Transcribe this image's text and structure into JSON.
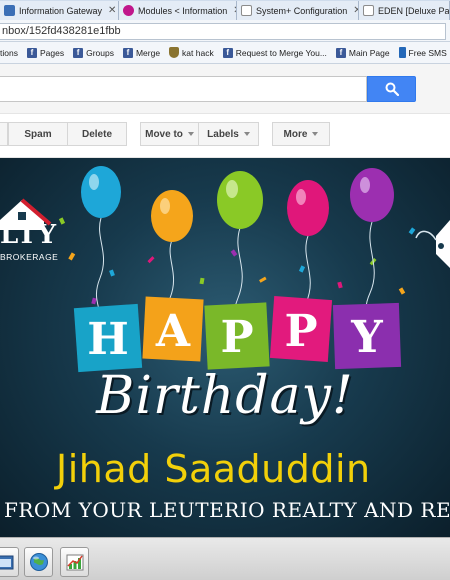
{
  "browser": {
    "tabs": [
      {
        "label": "Information Gateway",
        "icon": "fav-blue"
      },
      {
        "label": "Modules < Information",
        "icon": "fav-pink"
      },
      {
        "label": "System+ Configuration",
        "icon": "fav-doc"
      },
      {
        "label": "EDEN [Deluxe Packa",
        "icon": "fav-doc"
      }
    ],
    "address": "nbox/152fd438281e1fbb",
    "bookmarks": [
      {
        "label": "tions",
        "icon": "none"
      },
      {
        "label": "Pages",
        "icon": "facebook-icon"
      },
      {
        "label": "Groups",
        "icon": "facebook-icon"
      },
      {
        "label": "Merge",
        "icon": "facebook-icon"
      },
      {
        "label": "kat hack",
        "icon": "shield-icon"
      },
      {
        "label": "Request to Merge You...",
        "icon": "facebook-icon"
      },
      {
        "label": "Main Page",
        "icon": "facebook-icon"
      },
      {
        "label": "Free SMS",
        "icon": "mobile-icon"
      }
    ]
  },
  "gmail": {
    "search_value": "",
    "toolbar": {
      "spam": "Spam",
      "delete": "Delete",
      "move_to": "Move to",
      "labels": "Labels",
      "more": "More"
    }
  },
  "card": {
    "logo_main": "LTY",
    "logo_sub": "BROKERAGE",
    "happy_letters": [
      "H",
      "A",
      "P",
      "P",
      "Y"
    ],
    "birthday_word": "Birthday!",
    "celebrant": "Jihad Saaduddin",
    "greeting": "FROM YOUR LEUTERIO REALTY AND RENT.PH FAM",
    "colors": {
      "background": "#173a4d",
      "name": "#f2d00a",
      "balloons": [
        "#1ea7d8",
        "#f5a51b",
        "#8ac926",
        "#e0177a",
        "#9c2fb0"
      ],
      "tiles": [
        "#18a3c8",
        "#f4a21a",
        "#7ab829",
        "#e21a7d",
        "#8b2fae"
      ]
    }
  },
  "taskbar": {
    "items": [
      {
        "name": "taskbar-app-window-icon"
      },
      {
        "name": "taskbar-browser-globe-icon"
      },
      {
        "name": "taskbar-chart-app-icon"
      }
    ]
  }
}
